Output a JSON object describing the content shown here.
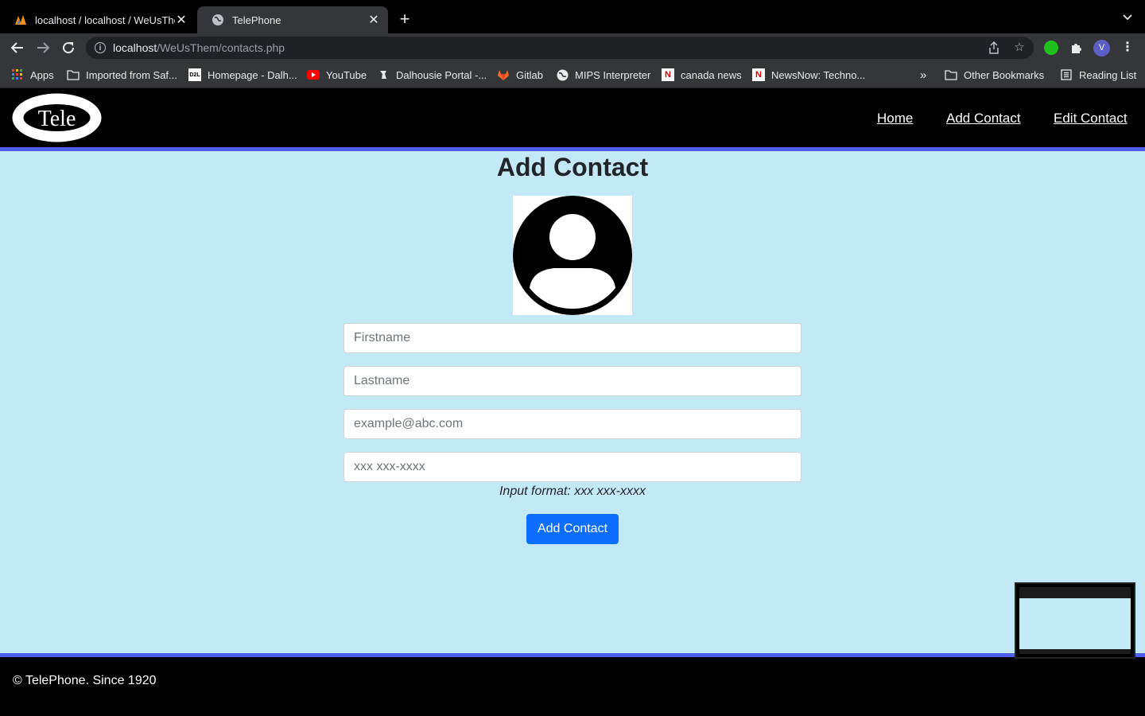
{
  "browser": {
    "tabs": [
      {
        "title": "localhost / localhost / WeUsThem",
        "active": false
      },
      {
        "title": "TelePhone",
        "active": true
      }
    ],
    "address": {
      "host": "localhost",
      "path": "/WeUsThem/contacts.php"
    },
    "bookmarks": [
      {
        "label": "Apps",
        "icon": "apps-grid-icon"
      },
      {
        "label": "Imported from Saf...",
        "icon": "folder-icon"
      },
      {
        "label": "Homepage - Dalh...",
        "icon": "d2l-icon"
      },
      {
        "label": "YouTube",
        "icon": "youtube-icon"
      },
      {
        "label": "Dalhousie Portal -...",
        "icon": "dal-icon"
      },
      {
        "label": "Gitlab",
        "icon": "gitlab-icon"
      },
      {
        "label": "MIPS Interpreter",
        "icon": "globe-icon"
      },
      {
        "label": "canada news",
        "icon": "newsnow-icon"
      },
      {
        "label": "NewsNow: Techno...",
        "icon": "newsnow-icon"
      }
    ],
    "overflow_label": "»",
    "other_bookmarks": "Other Bookmarks",
    "reading_list": "Reading List",
    "profile_initial": "V"
  },
  "site": {
    "logo_text": "Tele",
    "nav": [
      "Home",
      "Add Contact",
      "Edit Contact"
    ],
    "footer": "© TelePhone. Since 1920"
  },
  "form": {
    "title": "Add Contact",
    "firstname_placeholder": "Firstname",
    "lastname_placeholder": "Lastname",
    "email_placeholder": "example@abc.com",
    "phone_placeholder": "xxx xxx-xxxx",
    "phone_hint": "Input format: xxx xxx-xxxx",
    "submit_label": "Add Contact"
  },
  "colors": {
    "page_bg": "#c3e9f7",
    "accent_line": "#4d5ff0",
    "button": "#0d6efd"
  }
}
